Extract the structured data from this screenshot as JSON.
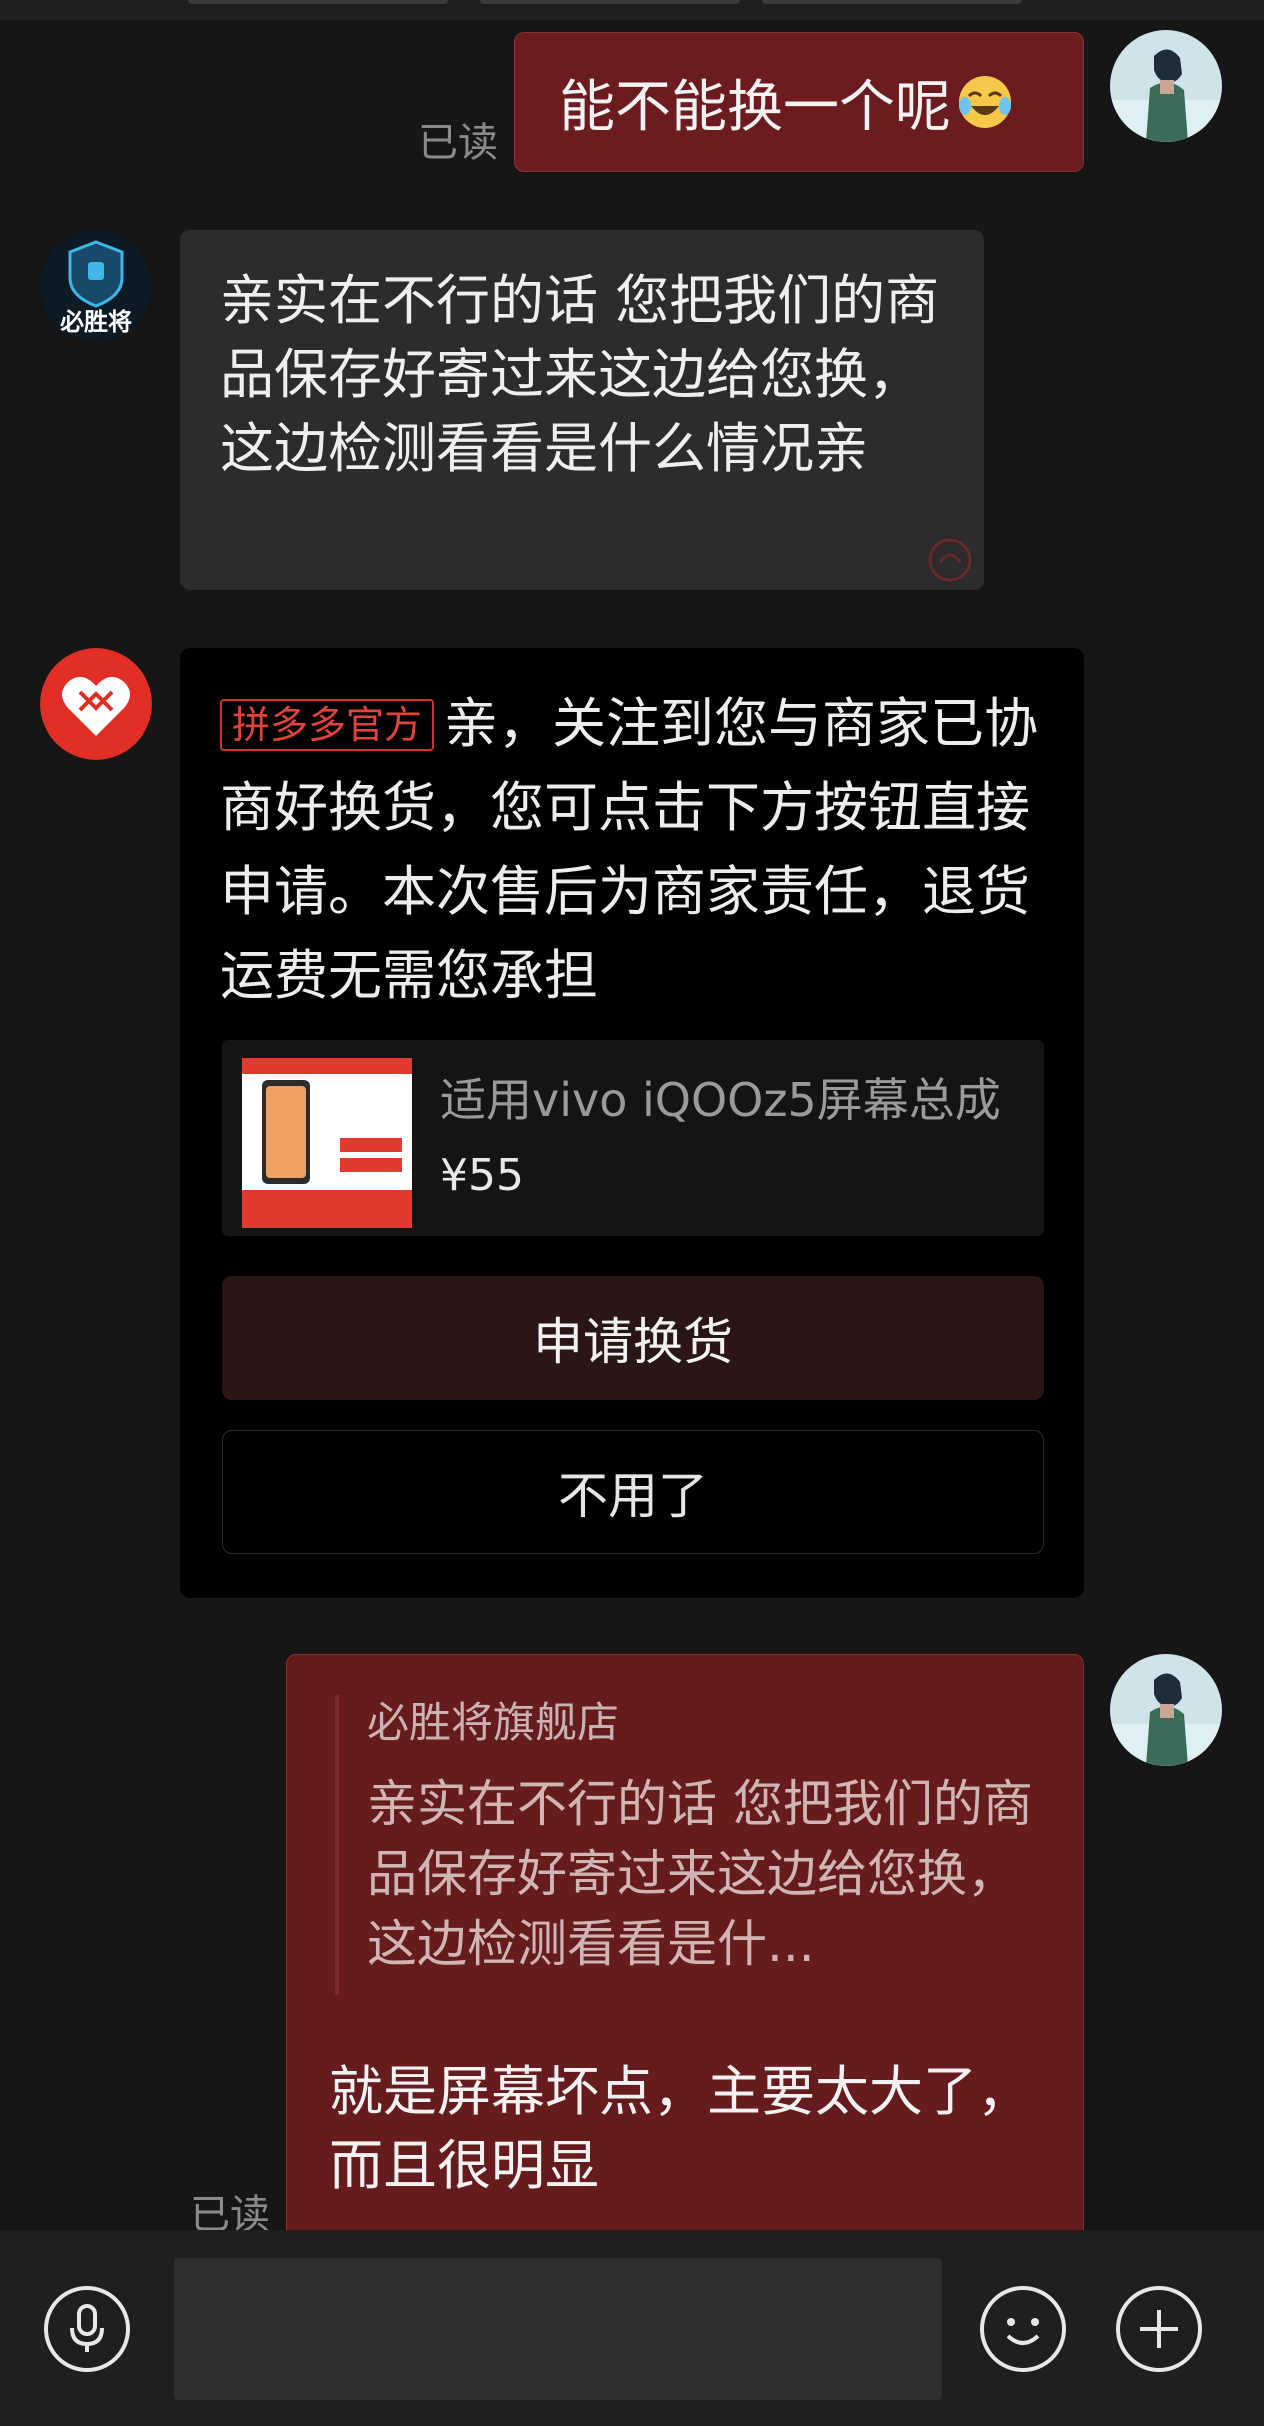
{
  "messages": {
    "out_1": {
      "text": "能不能换一个呢",
      "emoji": "crying-laughing-emoji",
      "status": "已读"
    },
    "in_1": {
      "text": "亲实在不行的话 您把我们的商品保存好寄过来这边给您换，这边检测看看是什么情况亲",
      "sender_logo": "必胜将"
    },
    "system_card": {
      "tag": "拼多多官方",
      "text": "亲，关注到您与商家已协商好换货，您可点击下方按钮直接申请。本次售后为商家责任，退货运费无需您承担",
      "product": {
        "title": "适用vivo iQOOz5屏幕总成",
        "price": "¥55"
      },
      "primary_button": "申请换货",
      "secondary_button": "不用了"
    },
    "out_2": {
      "quote_name": "必胜将旗舰店",
      "quote_text": "亲实在不行的话 您把我们的商品保存好寄过来这边给您换，这边检测看看是什...",
      "text": "就是屏幕坏点，主要太大了，而且很明显",
      "status": "已读"
    }
  },
  "input_bar": {
    "voice_icon": "microphone-icon",
    "emoji_icon": "smiley-icon",
    "more_icon": "plus-icon",
    "placeholder": ""
  },
  "colors": {
    "background": "#161616",
    "outgoing_bubble": "#6c1c1e",
    "incoming_bubble": "#2c2c2e",
    "pdd_red": "#e0433a"
  }
}
